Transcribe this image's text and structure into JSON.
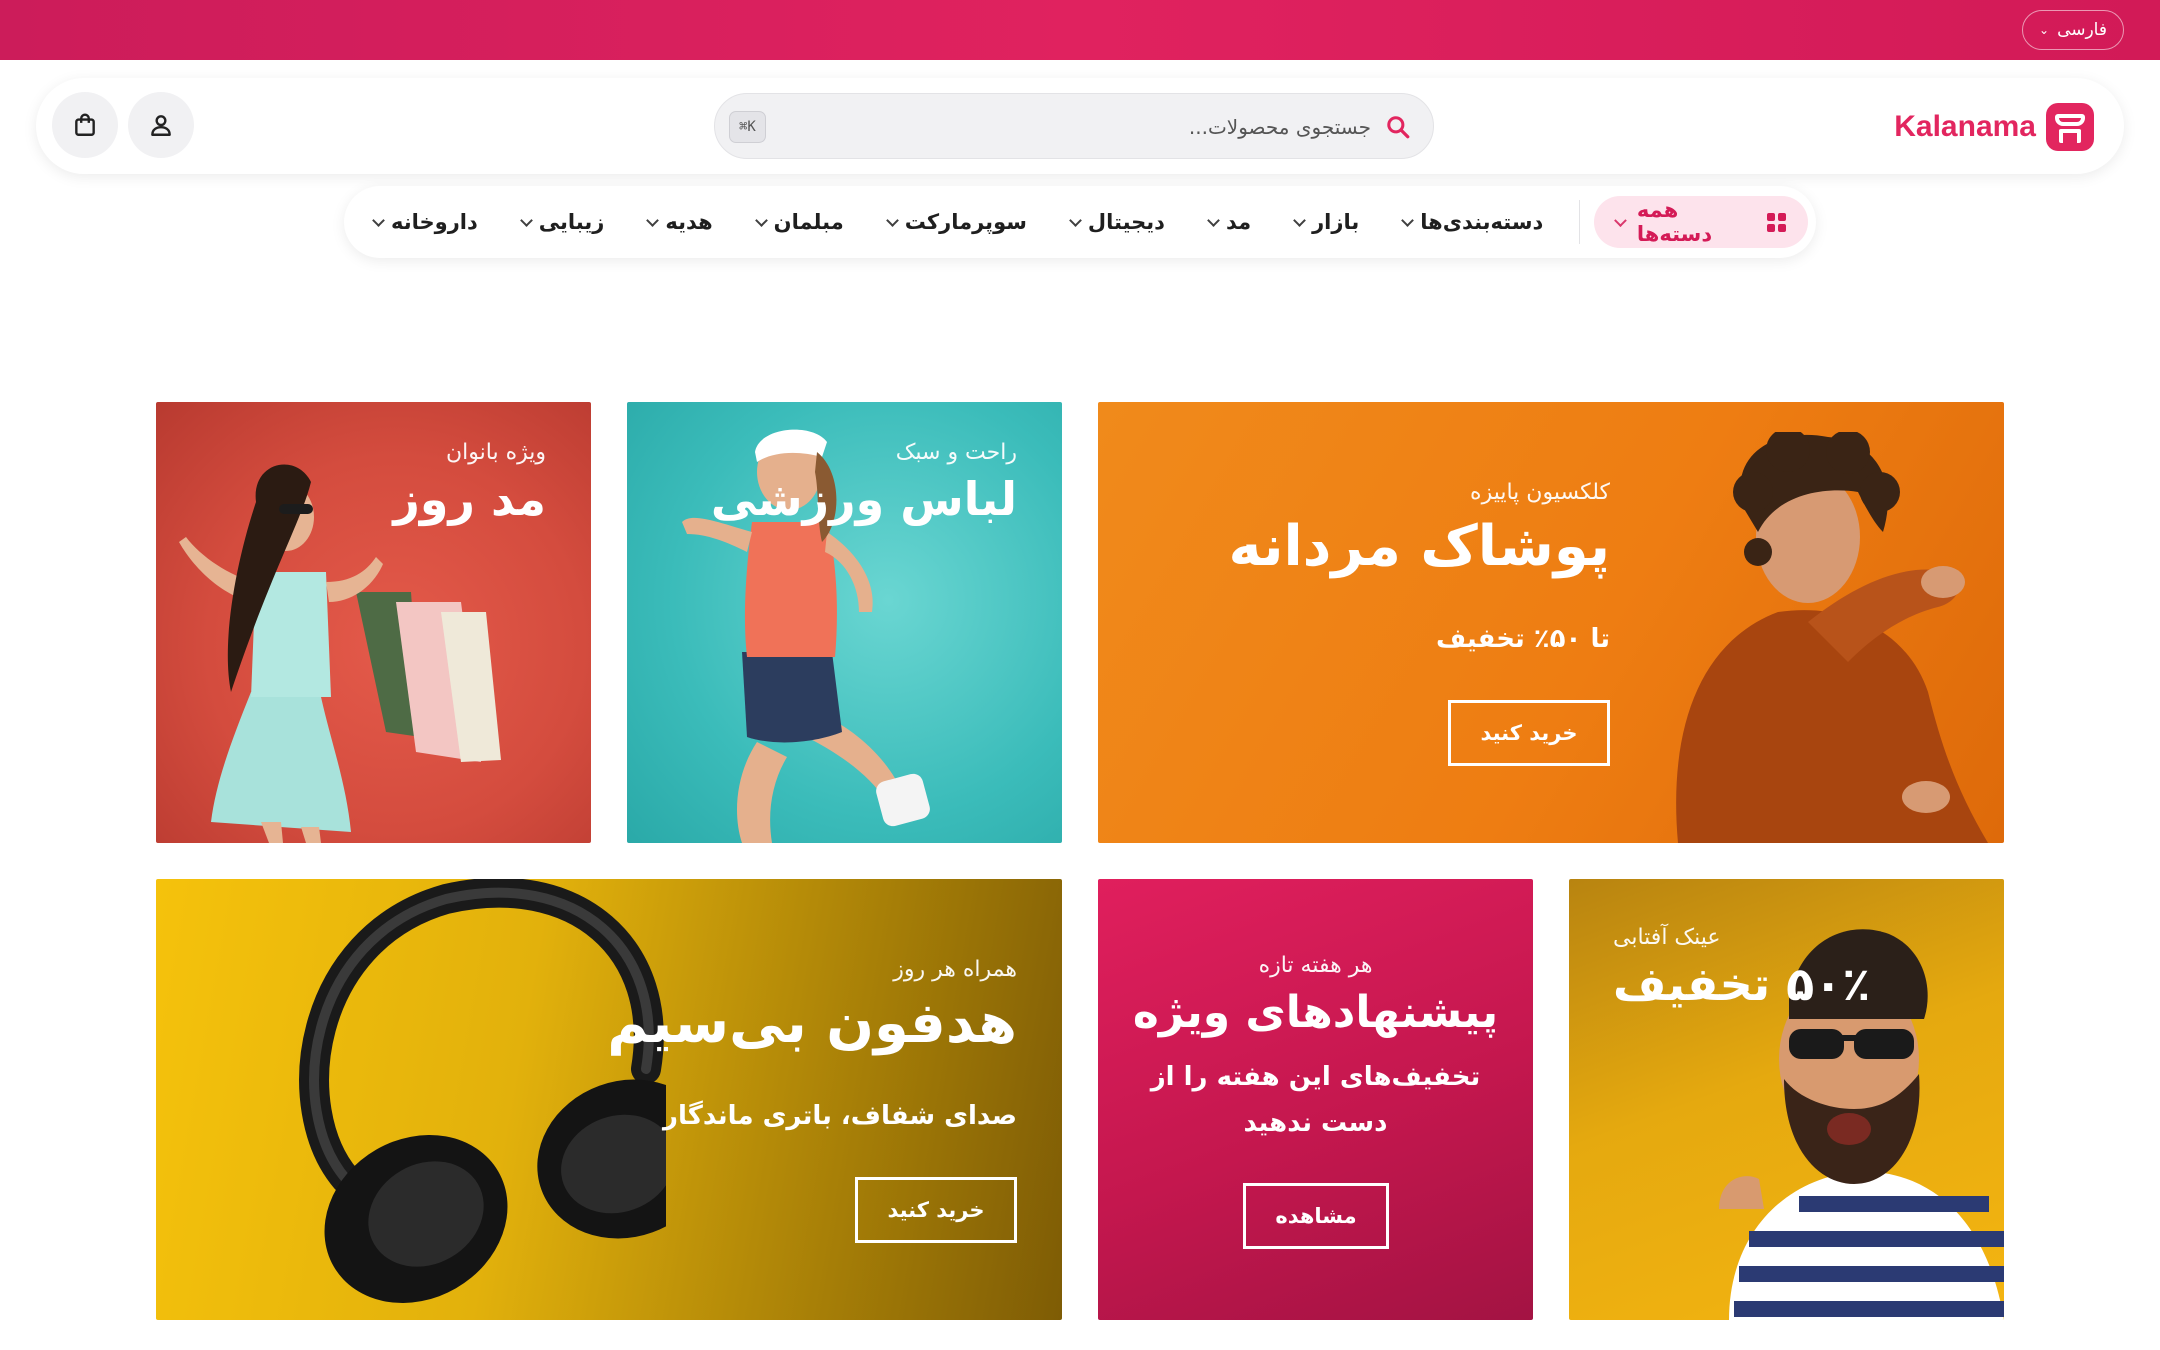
{
  "topbar": {
    "language": "فارسی",
    "color": "#e0225f"
  },
  "header": {
    "logo_text": "Kalanama",
    "logo_color": "#e2265f",
    "search": {
      "placeholder": "جستجوی محصولات...",
      "shortcut": "⌘K"
    },
    "icons": [
      "search-icon",
      "user-icon",
      "shopping-bag-icon",
      "store-icon"
    ]
  },
  "nav": {
    "all_categories": "همه دسته‌ها",
    "items": [
      "دسته‌بندی‌ها",
      "بازار",
      "مد",
      "دیجیتال",
      "سوپرمارکت",
      "مبلمان",
      "هدیه",
      "زیبایی",
      "داروخانه"
    ]
  },
  "banners": [
    {
      "eyebrow": "کلکسیون پاییزه",
      "title": "پوشاک مردانه",
      "subtitle": "تا ۵۰٪ تخفیف",
      "button": "خرید کنید",
      "color": "#ee7d12",
      "image": "man-in-sweater"
    },
    {
      "eyebrow": "راحت و سبک",
      "title": "لباس ورزشی",
      "color": "#3bbcba",
      "image": "woman-sportswear"
    },
    {
      "eyebrow": "ویژه بانوان",
      "title": "مد روز",
      "color": "#d44c3e",
      "image": "woman-shopping-bags"
    },
    {
      "eyebrow": "عینک آفتابی",
      "title": "۵۰٪ تخفیف",
      "color": "#f4b511",
      "image": "man-sunglasses"
    },
    {
      "eyebrow": "هر هفته تازه",
      "title": "پیشنهادهای ویژه",
      "subtitle_line1": "تخفیف‌های این هفته را از",
      "subtitle_line2": "دست ندهید",
      "button": "مشاهده",
      "color": "#c4174e"
    },
    {
      "eyebrow": "همراه هر روز",
      "title": "هدفون بی‌سیم",
      "subtitle": "صدای شفاف، باتری ماندگار",
      "button": "خرید کنید",
      "color": "#e2b10c",
      "image": "headphones"
    }
  ]
}
